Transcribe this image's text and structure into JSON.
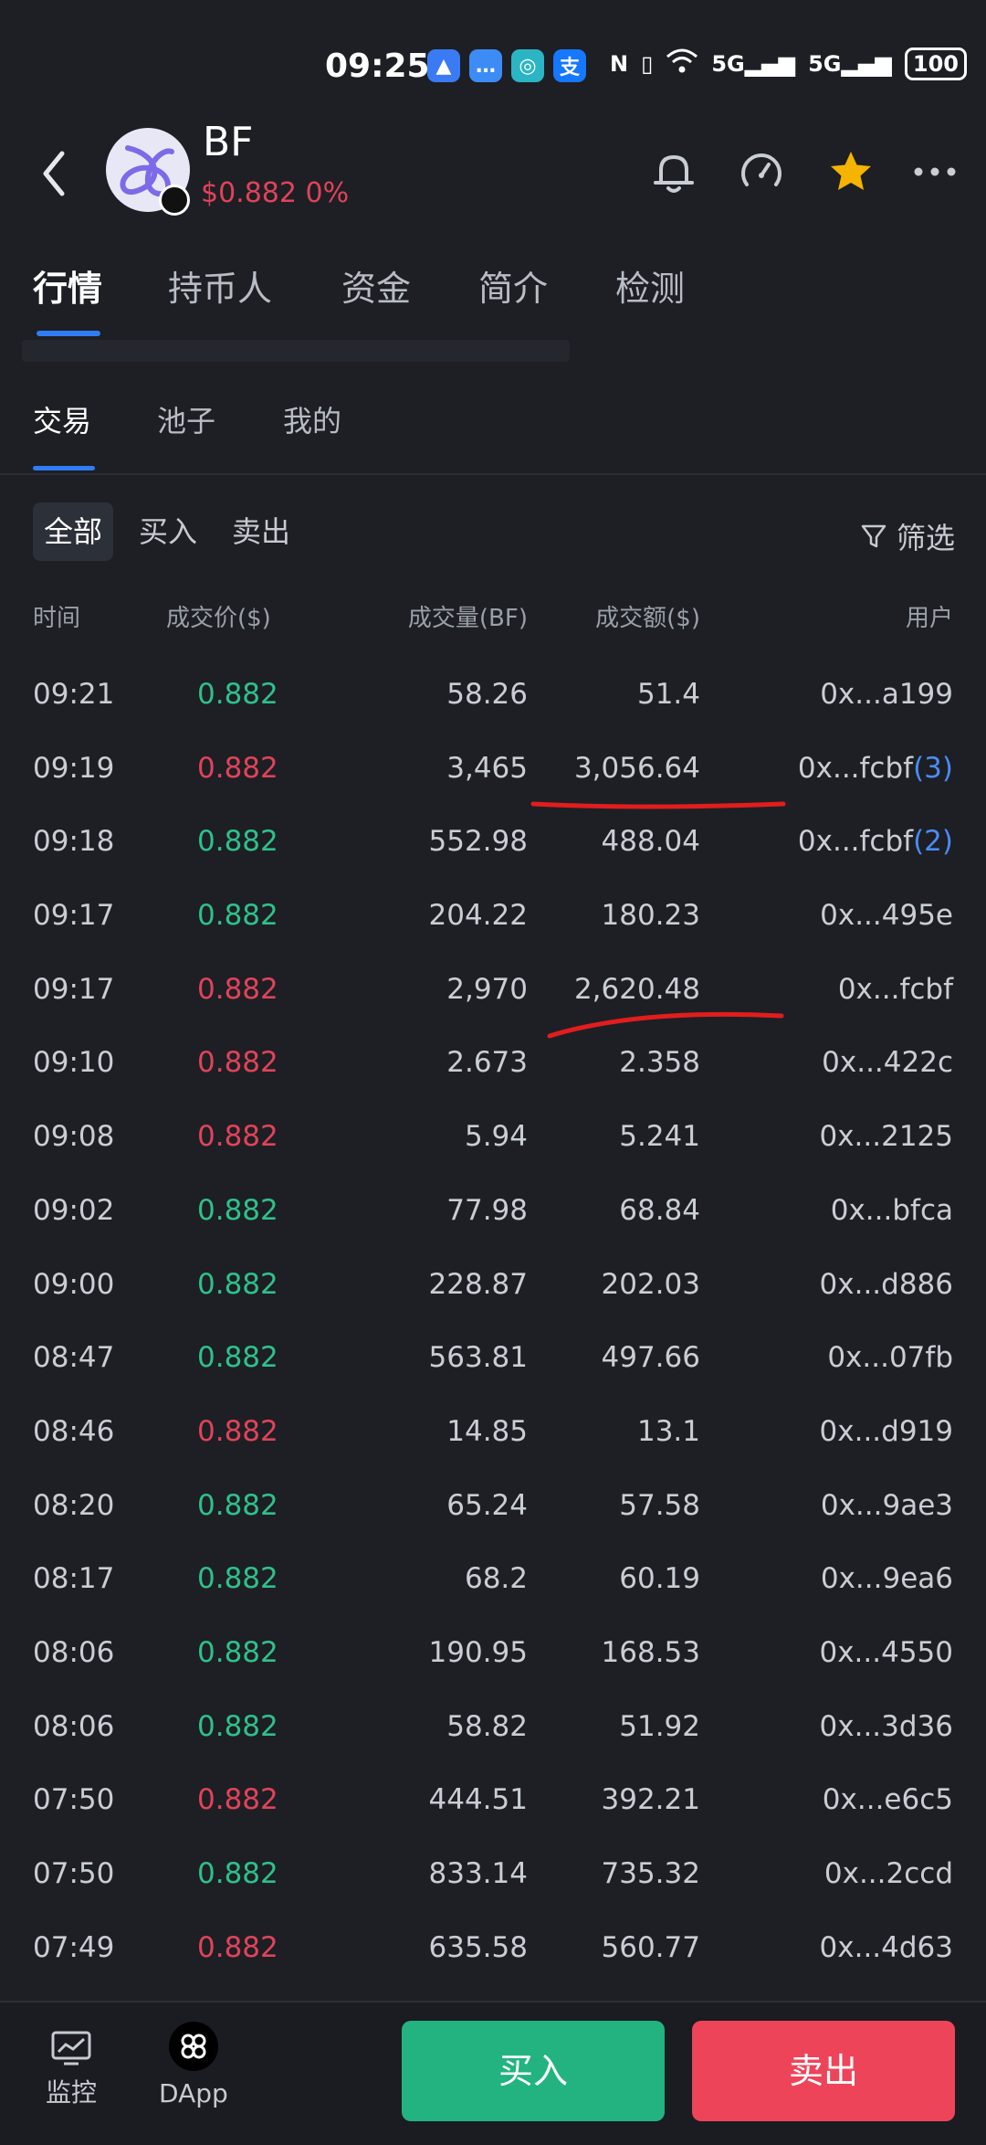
{
  "status_bar": {
    "time": "09:25",
    "app_icons": [
      {
        "name": "navigation-app-icon",
        "glyph": "▲",
        "color": "#3a7bf4"
      },
      {
        "name": "message-app-icon",
        "glyph": "…",
        "color": "#3d8cf5"
      },
      {
        "name": "browser-app-icon",
        "glyph": "◎",
        "color": "#2bb5c4"
      },
      {
        "name": "alipay-icon",
        "glyph": "支",
        "color": "#1677ff"
      }
    ],
    "nfc": "N",
    "signal_1": "5G",
    "signal_2": "5G",
    "battery": "100"
  },
  "header": {
    "token_name": "BF",
    "price_line": "$0.882 0%"
  },
  "main_tabs": [
    "行情",
    "持币人",
    "资金",
    "简介",
    "检测"
  ],
  "sub_tabs": [
    "交易",
    "池子",
    "我的"
  ],
  "filters": {
    "chips": [
      "全部",
      "买入",
      "卖出"
    ],
    "filter_label": "筛选"
  },
  "table": {
    "headers": {
      "time": "时间",
      "price": "成交价($)",
      "volume": "成交量(BF)",
      "amount": "成交额($)",
      "user": "用户"
    },
    "rows": [
      {
        "time": "09:21",
        "price": "0.882",
        "side": "up",
        "volume": "58.26",
        "amount": "51.4",
        "user": "0x...a199",
        "count": ""
      },
      {
        "time": "09:19",
        "price": "0.882",
        "side": "down",
        "volume": "3,465",
        "amount": "3,056.64",
        "user": "0x...fcbf",
        "count": "(3)"
      },
      {
        "time": "09:18",
        "price": "0.882",
        "side": "up",
        "volume": "552.98",
        "amount": "488.04",
        "user": "0x...fcbf",
        "count": "(2)"
      },
      {
        "time": "09:17",
        "price": "0.882",
        "side": "up",
        "volume": "204.22",
        "amount": "180.23",
        "user": "0x...495e",
        "count": ""
      },
      {
        "time": "09:17",
        "price": "0.882",
        "side": "down",
        "volume": "2,970",
        "amount": "2,620.48",
        "user": "0x...fcbf",
        "count": ""
      },
      {
        "time": "09:10",
        "price": "0.882",
        "side": "down",
        "volume": "2.673",
        "amount": "2.358",
        "user": "0x...422c",
        "count": ""
      },
      {
        "time": "09:08",
        "price": "0.882",
        "side": "down",
        "volume": "5.94",
        "amount": "5.241",
        "user": "0x...2125",
        "count": ""
      },
      {
        "time": "09:02",
        "price": "0.882",
        "side": "up",
        "volume": "77.98",
        "amount": "68.84",
        "user": "0x...bfca",
        "count": ""
      },
      {
        "time": "09:00",
        "price": "0.882",
        "side": "up",
        "volume": "228.87",
        "amount": "202.03",
        "user": "0x...d886",
        "count": ""
      },
      {
        "time": "08:47",
        "price": "0.882",
        "side": "up",
        "volume": "563.81",
        "amount": "497.66",
        "user": "0x...07fb",
        "count": ""
      },
      {
        "time": "08:46",
        "price": "0.882",
        "side": "down",
        "volume": "14.85",
        "amount": "13.1",
        "user": "0x...d919",
        "count": ""
      },
      {
        "time": "08:20",
        "price": "0.882",
        "side": "up",
        "volume": "65.24",
        "amount": "57.58",
        "user": "0x...9ae3",
        "count": ""
      },
      {
        "time": "08:17",
        "price": "0.882",
        "side": "up",
        "volume": "68.2",
        "amount": "60.19",
        "user": "0x...9ea6",
        "count": ""
      },
      {
        "time": "08:06",
        "price": "0.882",
        "side": "up",
        "volume": "190.95",
        "amount": "168.53",
        "user": "0x...4550",
        "count": ""
      },
      {
        "time": "08:06",
        "price": "0.882",
        "side": "up",
        "volume": "58.82",
        "amount": "51.92",
        "user": "0x...3d36",
        "count": ""
      },
      {
        "time": "07:50",
        "price": "0.882",
        "side": "down",
        "volume": "444.51",
        "amount": "392.21",
        "user": "0x...e6c5",
        "count": ""
      },
      {
        "time": "07:50",
        "price": "0.882",
        "side": "up",
        "volume": "833.14",
        "amount": "735.32",
        "user": "0x...2ccd",
        "count": ""
      },
      {
        "time": "07:49",
        "price": "0.882",
        "side": "down",
        "volume": "635.58",
        "amount": "560.77",
        "user": "0x...4d63",
        "count": ""
      }
    ]
  },
  "bottom_bar": {
    "monitor_label": "监控",
    "dapp_label": "DApp",
    "buy_label": "买入",
    "sell_label": "卖出"
  },
  "colors": {
    "up": "#2fc08a",
    "down": "#e0435a",
    "accent": "#2f7cf6",
    "star": "#f5b400",
    "annotation": "#e11d1d"
  }
}
